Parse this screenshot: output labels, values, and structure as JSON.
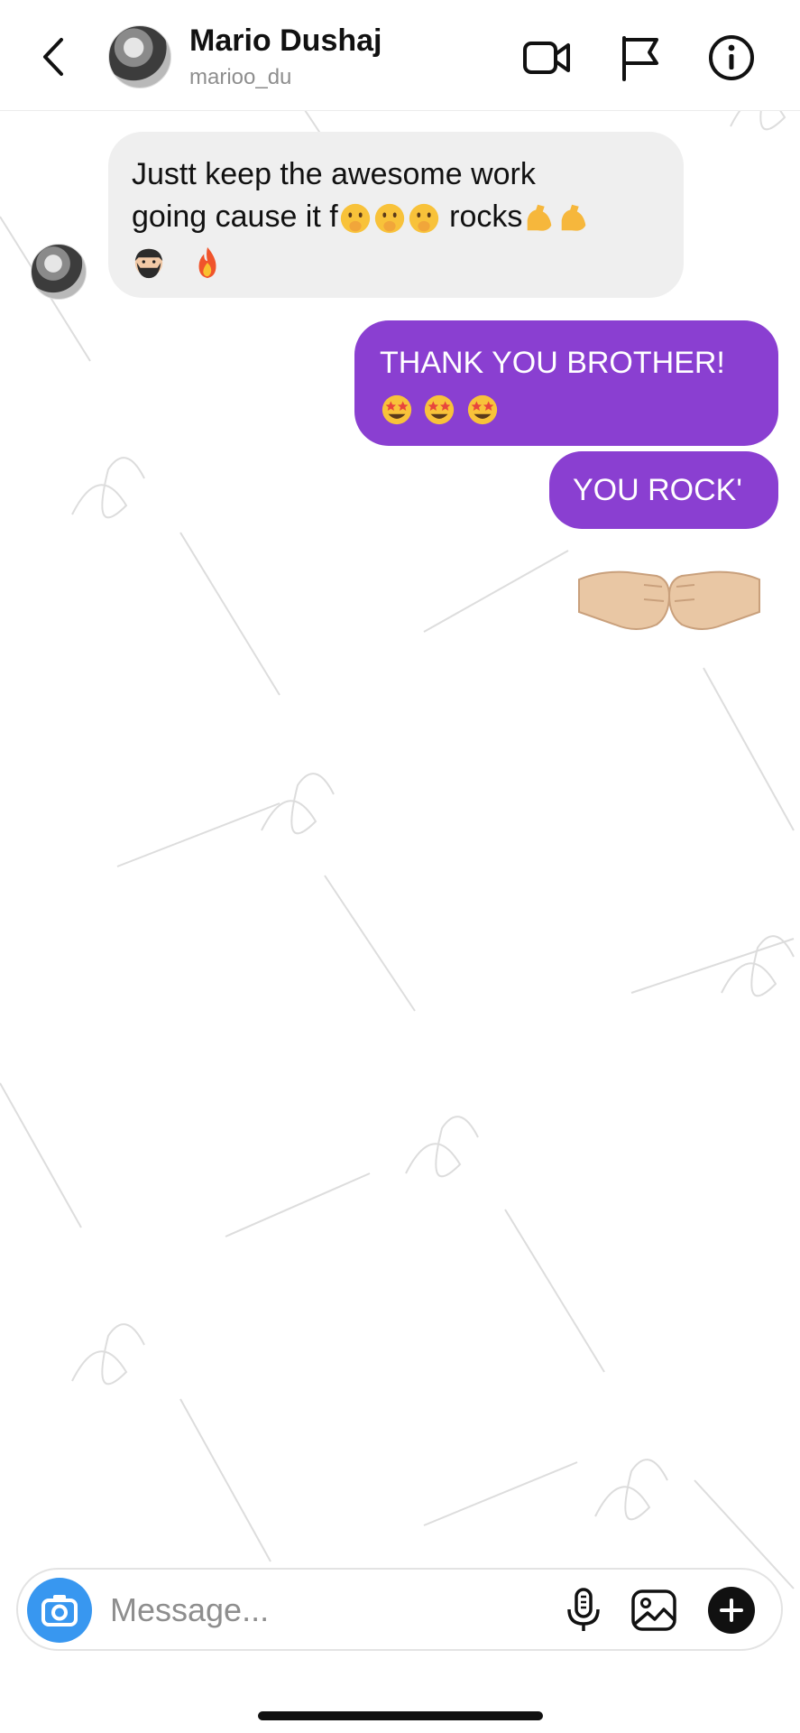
{
  "header": {
    "back_icon": "chevron-left-icon",
    "name": "Mario Dushaj",
    "username": "marioo_du",
    "icons": [
      "video-call-icon",
      "flag-icon",
      "info-icon"
    ]
  },
  "messages": {
    "incoming": {
      "line1": "Justt keep the awesome work",
      "line2_a": "going cause it f",
      "line2_b": " rocks",
      "emojis_inline": [
        "shushing-face",
        "shushing-face",
        "shushing-face"
      ],
      "emojis_after": [
        "flexed-biceps",
        "flexed-biceps"
      ],
      "emojis_row3": [
        "bearded-man",
        "fire"
      ]
    },
    "outgoing_1": {
      "text": "THANK YOU BROTHER!",
      "emojis": [
        "star-struck",
        "star-struck",
        "star-struck"
      ]
    },
    "outgoing_2": {
      "text": "YOU ROCK'"
    },
    "outgoing_3": {
      "emoji": "fist-bump"
    }
  },
  "composer": {
    "placeholder": "Message...",
    "icons": [
      "camera-icon",
      "microphone-icon",
      "gallery-icon",
      "plus-icon"
    ]
  },
  "colors": {
    "outgoing_bubble": "#8a3fd1",
    "incoming_bubble": "#efefef",
    "camera_button": "#3897f0",
    "subtext": "#8e8e8e"
  }
}
